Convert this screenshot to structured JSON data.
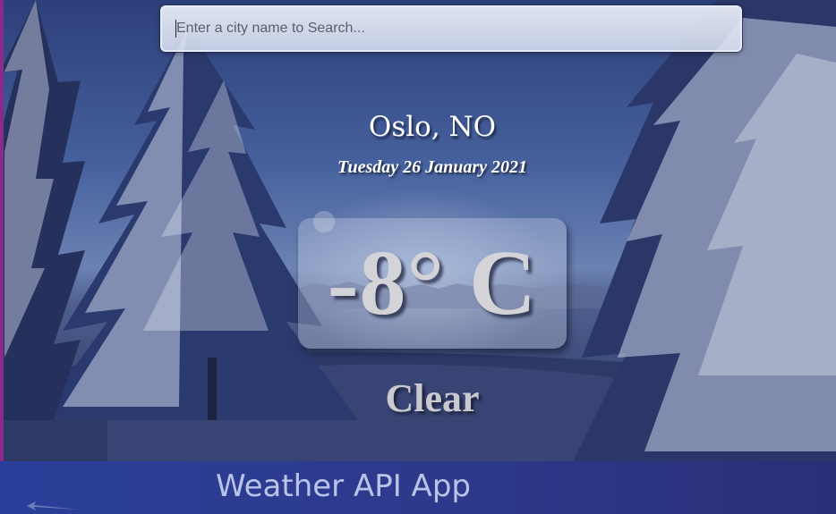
{
  "search": {
    "placeholder": "Enter a city name to Search...",
    "value": ""
  },
  "weather": {
    "location": "Oslo, NO",
    "date": "Tuesday 26 January 2021",
    "temperature": "-8° C",
    "condition": "Clear"
  },
  "footer": {
    "title": "Weather API App"
  },
  "colors": {
    "banner": "#2d3a8c",
    "text": "#ffffff",
    "temperature": "#d4d4d8"
  },
  "icons": [
    "search-caret",
    "arrow-icon"
  ]
}
